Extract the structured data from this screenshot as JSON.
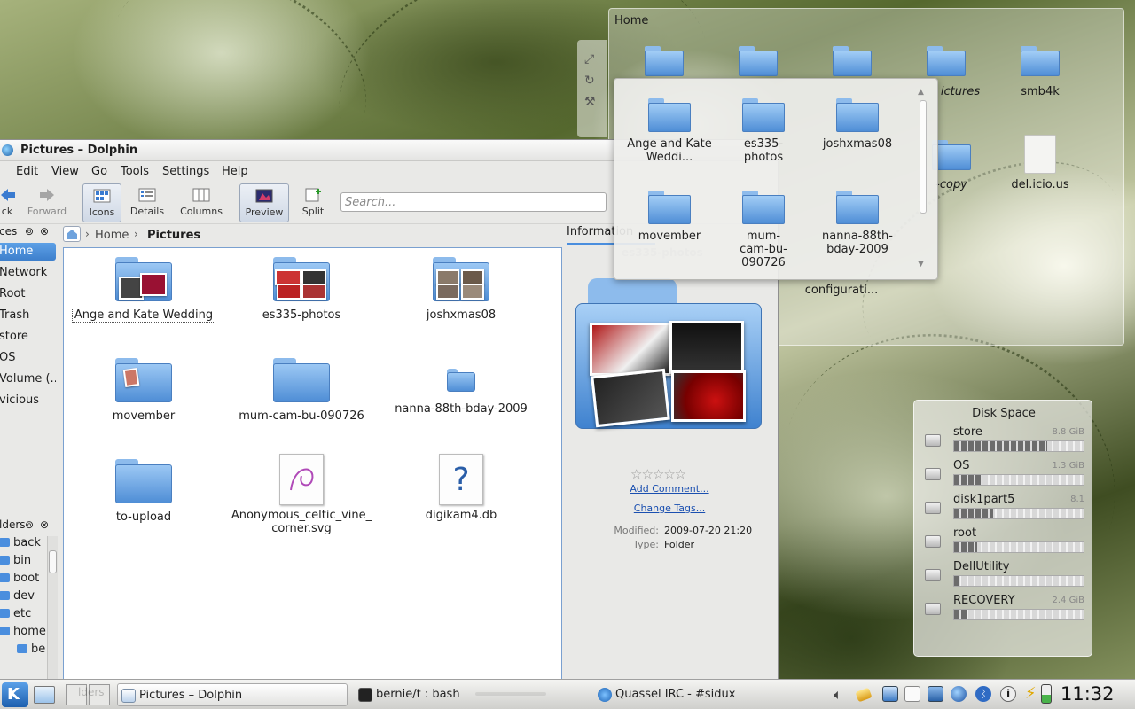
{
  "dolphin": {
    "title": "Pictures – Dolphin",
    "menu": [
      "Edit",
      "View",
      "Go",
      "Tools",
      "Settings",
      "Help"
    ],
    "toolbar": {
      "back": "ck",
      "forward": "Forward",
      "icons": "Icons",
      "details": "Details",
      "columns": "Columns",
      "preview": "Preview",
      "split": "Split"
    },
    "search_placeholder": "Search...",
    "places": {
      "header": "ces",
      "items": [
        "Home",
        "Network",
        "Root",
        "Trash",
        "store",
        "OS",
        "Volume (...",
        "vicious"
      ]
    },
    "folders": {
      "header": "lders",
      "items": [
        "back",
        "bin",
        "boot",
        "dev",
        "etc",
        "home",
        "be"
      ]
    },
    "breadcrumb": {
      "home": "Home",
      "current": "Pictures"
    },
    "files": [
      {
        "name": "Ange and Kate Wedding"
      },
      {
        "name": "es335-photos"
      },
      {
        "name": "joshxmas08"
      },
      {
        "name": "movember"
      },
      {
        "name": "mum-cam-bu-090726"
      },
      {
        "name": "nanna-88th-bday-2009"
      },
      {
        "name": "to-upload"
      },
      {
        "name": "Anonymous_celtic_vine_ corner.svg"
      },
      {
        "name": "digikam4.db"
      }
    ],
    "info": {
      "tab": "Information",
      "ghost_name": "es335-photos",
      "add_comment": "Add Comment...",
      "change_tags": "Change Tags...",
      "modified_label": "Modified:",
      "modified_value": "2009-07-20 21:20",
      "type_label": "Type:",
      "type_value": "Folder",
      "rating": 0
    }
  },
  "home_view": {
    "title": "Home",
    "visible": [
      "ictures",
      "smb4k",
      "-copy",
      "del.icio.us",
      "configurati..."
    ]
  },
  "popup": {
    "items": [
      "Ange and Kate Weddi...",
      "es335-photos",
      "joshxmas08",
      "movember",
      "mum-cam-bu-090726",
      "nanna-88th-bday-2009"
    ]
  },
  "disk_space": {
    "title": "Disk Space",
    "disks": [
      {
        "name": "store",
        "size": "8.8 GiB",
        "used": 0.72
      },
      {
        "name": "OS",
        "size": "1.3 GiB",
        "used": 0.22
      },
      {
        "name": "disk1part5",
        "size": "8.1",
        "used": 0.3
      },
      {
        "name": "root",
        "size": "",
        "used": 0.18
      },
      {
        "name": "DellUtility",
        "size": "",
        "used": 0.05
      },
      {
        "name": "RECOVERY",
        "size": "2.4 GiB",
        "used": 0.1
      }
    ]
  },
  "taskbar": {
    "tasks": [
      "Pictures – Dolphin",
      "bernie/t : bash",
      "Quassel IRC - #sidux"
    ],
    "ghost": "lders",
    "clock": "11:32"
  }
}
